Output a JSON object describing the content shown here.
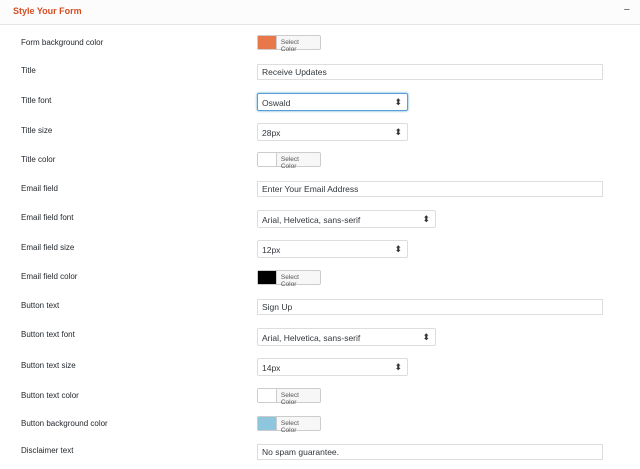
{
  "panel": {
    "title": "Style Your Form",
    "toggle": "−"
  },
  "rows": {
    "bg_color": {
      "label": "Form background color",
      "button": "Select Color",
      "color": "#e8784a"
    },
    "title": {
      "label": "Title",
      "value": "Receive Updates"
    },
    "title_font": {
      "label": "Title font",
      "value": "Oswald"
    },
    "title_size": {
      "label": "Title size",
      "value": "28px"
    },
    "title_color": {
      "label": "Title color",
      "button": "Select Color",
      "color": "#ffffff"
    },
    "email_field": {
      "label": "Email field",
      "value": "Enter Your Email Address"
    },
    "email_font": {
      "label": "Email field font",
      "value": "Arial, Helvetica, sans-serif"
    },
    "email_size": {
      "label": "Email field size",
      "value": "12px"
    },
    "email_color": {
      "label": "Email field color",
      "button": "Select Color",
      "color": "#000000"
    },
    "button_text": {
      "label": "Button text",
      "value": "Sign Up"
    },
    "button_font": {
      "label": "Button text font",
      "value": "Arial, Helvetica, sans-serif"
    },
    "button_size": {
      "label": "Button text size",
      "value": "14px"
    },
    "button_color": {
      "label": "Button text color",
      "button": "Select Color",
      "color": "#ffffff"
    },
    "button_bg": {
      "label": "Button background color",
      "button": "Select Color",
      "color": "#8ec6de"
    },
    "disclaimer": {
      "label": "Disclaimer text",
      "value": "No spam guarantee."
    }
  },
  "icons": {
    "select_arrow": "⬍"
  }
}
